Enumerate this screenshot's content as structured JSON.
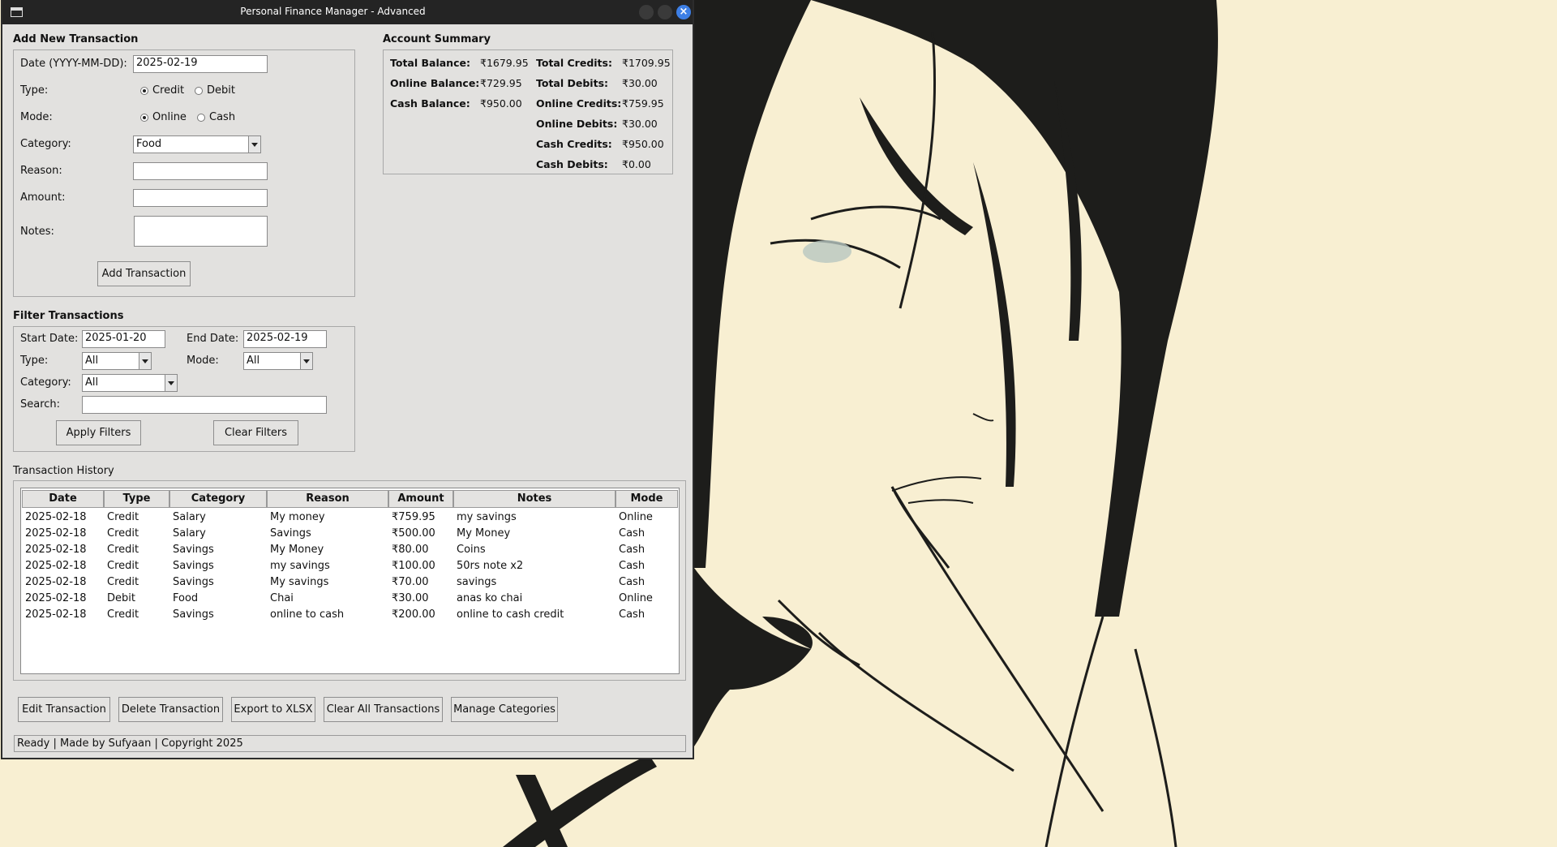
{
  "window": {
    "title": "Personal Finance Manager - Advanced"
  },
  "add_section": {
    "title": "Add New Transaction",
    "date_label": "Date (YYYY-MM-DD):",
    "date_value": "2025-02-19",
    "type_label": "Type:",
    "type_options": [
      "Credit",
      "Debit"
    ],
    "mode_label": "Mode:",
    "mode_options": [
      "Online",
      "Cash"
    ],
    "category_label": "Category:",
    "category_value": "Food",
    "reason_label": "Reason:",
    "reason_value": "",
    "amount_label": "Amount:",
    "amount_value": "",
    "notes_label": "Notes:",
    "notes_value": "",
    "add_button": "Add Transaction"
  },
  "summary": {
    "title": "Account Summary",
    "total_balance_label": "Total Balance:",
    "total_balance": "₹1679.95",
    "online_balance_label": "Online Balance:",
    "online_balance": "₹729.95",
    "cash_balance_label": "Cash Balance:",
    "cash_balance": "₹950.00",
    "total_credits_label": "Total Credits:",
    "total_credits": "₹1709.95",
    "total_debits_label": "Total Debits:",
    "total_debits": "₹30.00",
    "online_credits_label": "Online Credits:",
    "online_credits": "₹759.95",
    "online_debits_label": "Online Debits:",
    "online_debits": "₹30.00",
    "cash_credits_label": "Cash Credits:",
    "cash_credits": "₹950.00",
    "cash_debits_label": "Cash Debits:",
    "cash_debits": "₹0.00"
  },
  "filter": {
    "title": "Filter Transactions",
    "start_label": "Start Date:",
    "start_value": "2025-01-20",
    "end_label": "End Date:",
    "end_value": "2025-02-19",
    "type_label": "Type:",
    "type_value": "All",
    "mode_label": "Mode:",
    "mode_value": "All",
    "category_label": "Category:",
    "category_value": "All",
    "search_label": "Search:",
    "search_value": "",
    "apply_button": "Apply Filters",
    "clear_button": "Clear Filters"
  },
  "history": {
    "title": "Transaction History",
    "columns": [
      "Date",
      "Type",
      "Category",
      "Reason",
      "Amount",
      "Notes",
      "Mode"
    ],
    "rows": [
      [
        "2025-02-18",
        "Credit",
        "Salary",
        "My money",
        "₹759.95",
        "my savings",
        "Online"
      ],
      [
        "2025-02-18",
        "Credit",
        "Salary",
        "Savings",
        "₹500.00",
        "My Money",
        "Cash"
      ],
      [
        "2025-02-18",
        "Credit",
        "Savings",
        "My Money",
        "₹80.00",
        "Coins",
        "Cash"
      ],
      [
        "2025-02-18",
        "Credit",
        "Savings",
        "my savings",
        "₹100.00",
        "50rs note x2",
        "Cash"
      ],
      [
        "2025-02-18",
        "Credit",
        "Savings",
        "My savings",
        "₹70.00",
        "savings",
        "Cash"
      ],
      [
        "2025-02-18",
        "Debit",
        "Food",
        "Chai",
        "₹30.00",
        "anas ko chai",
        "Online"
      ],
      [
        "2025-02-18",
        "Credit",
        "Savings",
        "online to cash",
        "₹200.00",
        "online to cash credit",
        "Cash"
      ]
    ]
  },
  "actions": {
    "edit": "Edit Transaction",
    "delete": "Delete Transaction",
    "export": "Export to XLSX",
    "clear_all": "Clear All Transactions",
    "manage": "Manage Categories"
  },
  "status": {
    "text": "Ready | Made by Sufyaan | Copyright 2025"
  }
}
